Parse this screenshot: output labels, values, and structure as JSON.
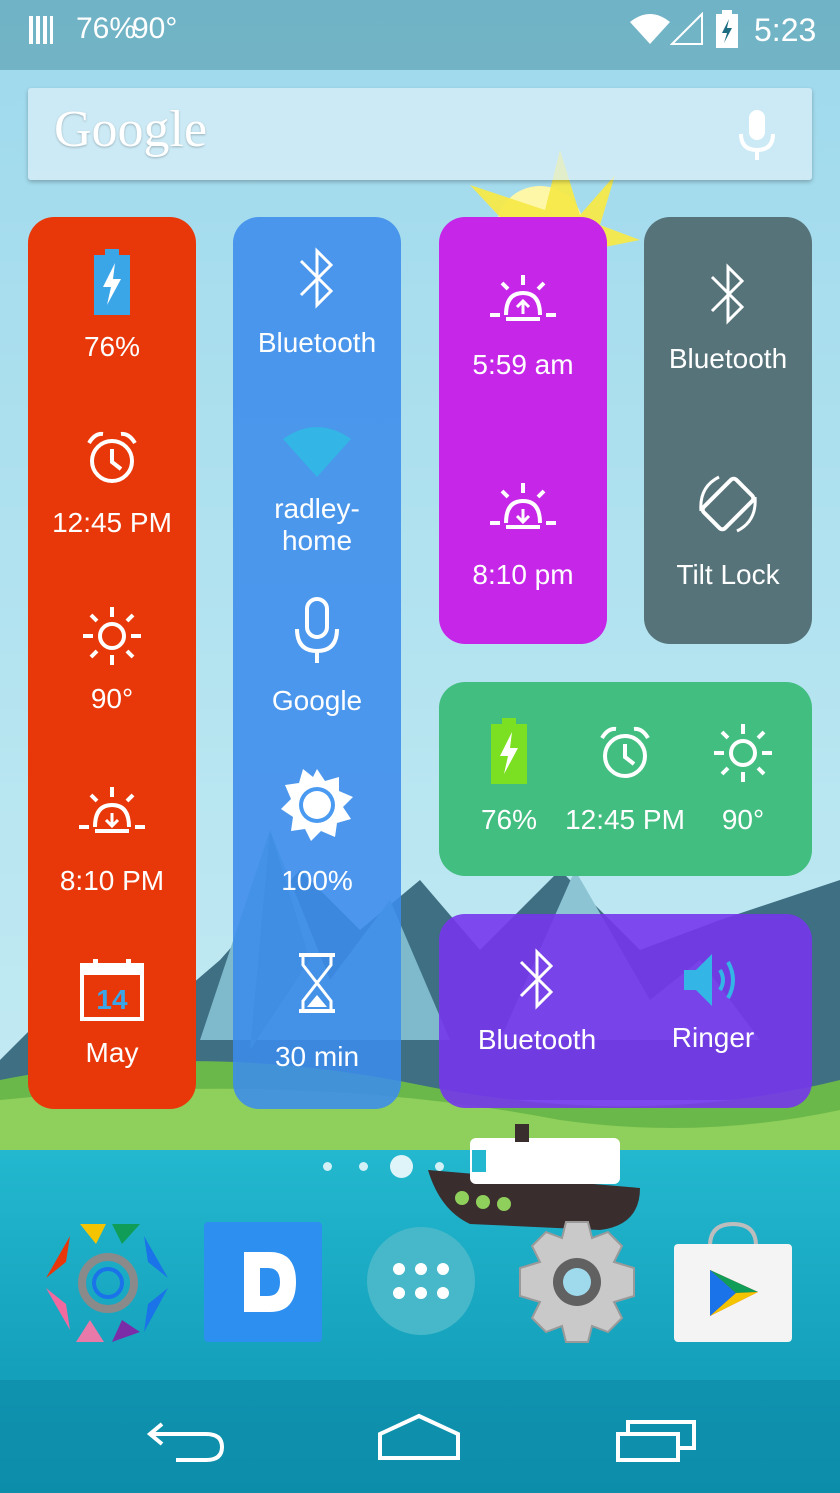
{
  "status_bar": {
    "battery_percent": "76%",
    "temperature": "90°",
    "time": "5:23",
    "icons": [
      "notification-icon",
      "wifi-icon",
      "cell-signal-icon",
      "battery-charging-icon"
    ]
  },
  "search": {
    "logo": "Google",
    "icons": [
      "mic-icon"
    ]
  },
  "widget_red": {
    "color": "#E8380A",
    "items": [
      {
        "icon": "battery-charging-icon",
        "label": "76%"
      },
      {
        "icon": "alarm-clock-icon",
        "label": "12:45 PM"
      },
      {
        "icon": "sun-icon",
        "label": "90°"
      },
      {
        "icon": "sunset-icon",
        "label": "8:10 PM"
      },
      {
        "icon": "calendar-icon",
        "label": "May",
        "day": "14"
      }
    ]
  },
  "widget_blue": {
    "color": "#4A9AF2",
    "items": [
      {
        "icon": "bluetooth-icon",
        "label": "Bluetooth"
      },
      {
        "icon": "wifi-icon",
        "label": "radley-\nhome"
      },
      {
        "icon": "mic-icon",
        "label": "Google"
      },
      {
        "icon": "brightness-icon",
        "label": "100%"
      },
      {
        "icon": "hourglass-icon",
        "label": "30 min"
      }
    ]
  },
  "widget_magenta": {
    "color": "#C526E8",
    "items": [
      {
        "icon": "sunrise-icon",
        "label": "5:59 am"
      },
      {
        "icon": "sunset-icon",
        "label": "8:10 pm"
      }
    ]
  },
  "widget_slate": {
    "color": "#56737A",
    "items": [
      {
        "icon": "bluetooth-icon",
        "label": "Bluetooth"
      },
      {
        "icon": "rotation-icon",
        "label": "Tilt Lock"
      }
    ]
  },
  "widget_green": {
    "color": "#42BE80",
    "items": [
      {
        "icon": "battery-charging-icon",
        "label": "76%"
      },
      {
        "icon": "alarm-clock-icon",
        "label": "12:45 PM"
      },
      {
        "icon": "sun-icon",
        "label": "90°"
      }
    ]
  },
  "widget_purple": {
    "color": "#7B3EEA",
    "items": [
      {
        "icon": "bluetooth-icon",
        "label": "Bluetooth"
      },
      {
        "icon": "speaker-icon",
        "label": "Ringer"
      }
    ]
  },
  "page_indicator": {
    "pages": 5,
    "current": 3
  },
  "dock": {
    "apps": [
      {
        "icon": "hex-app-icon"
      },
      {
        "icon": "dropbox-d-icon",
        "letter": "D"
      },
      {
        "icon": "app-drawer-icon"
      },
      {
        "icon": "settings-gear-icon"
      },
      {
        "icon": "play-store-icon"
      }
    ]
  },
  "nav_bar": {
    "icons": [
      "back-icon",
      "home-icon",
      "recents-icon"
    ]
  }
}
